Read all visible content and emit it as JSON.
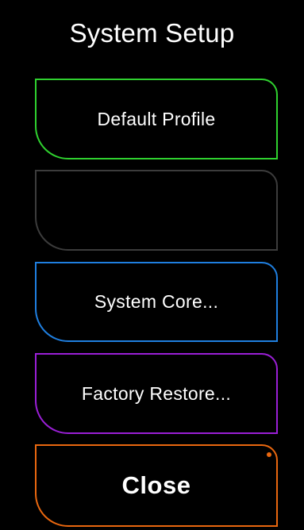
{
  "title": "System Setup",
  "buttons": {
    "default_profile": {
      "label": "Default Profile",
      "color": "#2fd12f"
    },
    "empty_slot": {
      "label": "",
      "color": "#3c3c3c"
    },
    "system_core": {
      "label": "System Core...",
      "color": "#1f7fe0"
    },
    "factory_restore": {
      "label": "Factory Restore...",
      "color": "#9a1fd6"
    },
    "close": {
      "label": "Close",
      "color": "#e9670f",
      "indicator_color": "#e9670f"
    }
  }
}
